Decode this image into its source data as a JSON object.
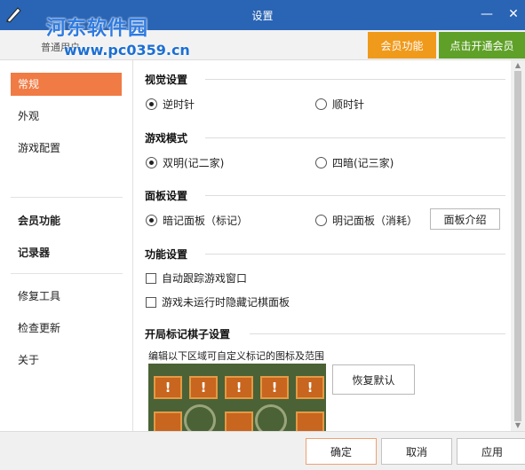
{
  "window": {
    "title": "设置",
    "minimize": "—",
    "close": "✕"
  },
  "watermark": {
    "name": "河东软件园",
    "url": "www.pc0359.cn"
  },
  "account": {
    "user_type": "普通用户",
    "member_button": "会员功能",
    "open_button": "点击开通会员"
  },
  "sidebar": {
    "items": [
      {
        "label": "常规"
      },
      {
        "label": "外观"
      },
      {
        "label": "游戏配置"
      },
      {
        "label": "会员功能"
      },
      {
        "label": "记录器"
      },
      {
        "label": "修复工具"
      },
      {
        "label": "检查更新"
      },
      {
        "label": "关于"
      }
    ]
  },
  "visual": {
    "title": "视觉设置",
    "counterclockwise": "逆时针",
    "clockwise": "顺时针"
  },
  "game_mode": {
    "title": "游戏模式",
    "double_bright": "双明(记二家)",
    "four_dark": "四暗(记三家)"
  },
  "panel": {
    "title": "面板设置",
    "dark_panel": "暗记面板（标记）",
    "bright_panel": "明记面板（消耗）",
    "intro_button": "面板介绍"
  },
  "features": {
    "title": "功能设置",
    "auto_track": "自动跟踪游戏窗口",
    "hide_panel": "游戏未运行时隐藏记棋面板"
  },
  "opening": {
    "title": "开局标记棋子设置",
    "hint": "编辑以下区域可自定义标记的图标及范围",
    "reset_button": "恢复默认",
    "piece_mark": "!"
  },
  "footer": {
    "ok": "确定",
    "cancel": "取消",
    "apply": "应用"
  },
  "colors": {
    "titlebar": "#2a64b4",
    "active_nav": "#f07b44",
    "member": "#f09a1c",
    "open_member": "#5fa128",
    "board": "#4a6236"
  }
}
